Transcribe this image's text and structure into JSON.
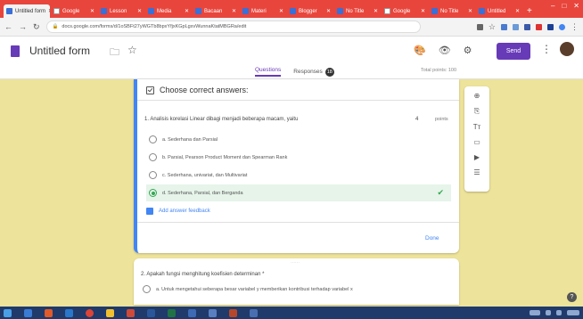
{
  "browser": {
    "tabs": [
      {
        "label": "Untitled form",
        "active": true
      },
      {
        "label": "Google",
        "active": false
      },
      {
        "label": "Lesson",
        "active": false
      },
      {
        "label": "Media",
        "active": false
      },
      {
        "label": "Bacaan",
        "active": false
      },
      {
        "label": "Materi",
        "active": false
      },
      {
        "label": "Blogger",
        "active": false
      },
      {
        "label": "No Title",
        "active": false
      },
      {
        "label": "Google",
        "active": false
      },
      {
        "label": "No Title",
        "active": false
      },
      {
        "label": "Untitled",
        "active": false
      }
    ],
    "new_tab": "+",
    "window_controls": [
      "–",
      "□",
      "✕"
    ],
    "url": "docs.google.com/forms/d/1oSBFt27yWGTb8bpxYfjxKGpLgxvWunnaKtatMBGRa/edit",
    "nav": {
      "back": "←",
      "forward": "→",
      "reload": "↻"
    }
  },
  "header": {
    "title": "Untitled form",
    "send_label": "Send",
    "tabs": [
      {
        "label": "Questions",
        "active": true
      },
      {
        "label": "Responses",
        "badge": "18"
      }
    ],
    "total_points": "Total points: 100"
  },
  "question1": {
    "answer_header": "Choose correct answers:",
    "text": "1. Analisis korelasi Linear dibagi menjadi beberapa macam, yaitu",
    "points_value": "4",
    "points_label": "points",
    "options": [
      {
        "label": "a. Sederhana dan Parsial",
        "correct": false
      },
      {
        "label": "b. Parsial, Pearson Product Moment dan Spearman Rank",
        "correct": false
      },
      {
        "label": "c. Sederhana, univariat, dan Multivariat",
        "correct": false
      },
      {
        "label": "d. Sederhana, Parsial, dan Berganda",
        "correct": true
      }
    ],
    "feedback_label": "Add answer feedback",
    "done_label": "Done"
  },
  "question2": {
    "text": "2. Apakah fungsi menghitung koefisien determinan *",
    "option": "a. Untuk mengetahui seberapa besar variabel y memberikan kontribusi terhadap variabel x"
  },
  "side_tools": [
    "⊕",
    "⎘",
    "Tт",
    "▭",
    "▶",
    "☰"
  ],
  "colors": {
    "accent": "#673ab7",
    "active_card": "#4285f4",
    "correct": "#34a853",
    "background": "#ede39a",
    "tabbar": "#e8453c"
  }
}
